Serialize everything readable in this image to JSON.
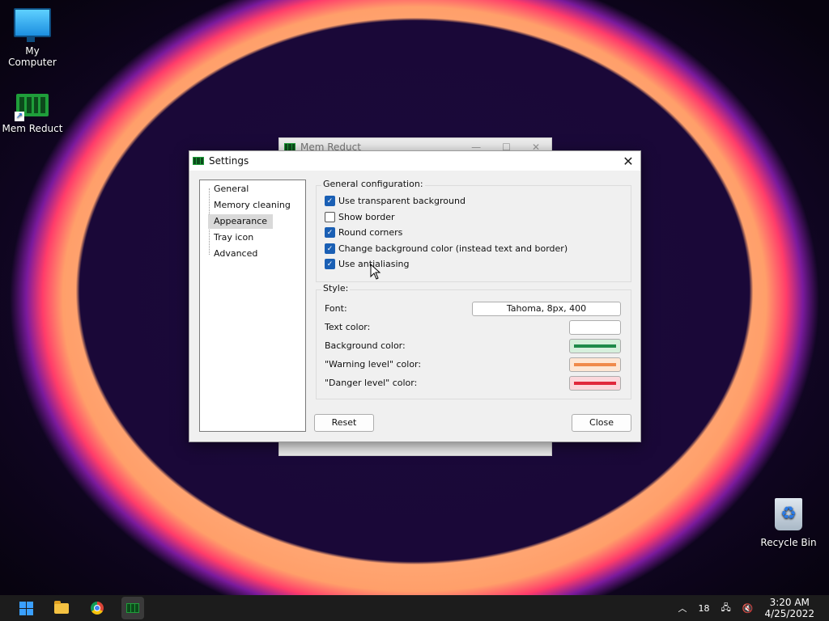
{
  "desktop": {
    "icons": [
      {
        "label": "My Computer"
      },
      {
        "label": "Mem Reduct"
      },
      {
        "label": "Recycle Bin"
      }
    ]
  },
  "background_window": {
    "title": "Mem Reduct"
  },
  "settings": {
    "title": "Settings",
    "close_glyph": "✕",
    "nav": [
      {
        "label": "General"
      },
      {
        "label": "Memory cleaning"
      },
      {
        "label": "Appearance",
        "selected": true
      },
      {
        "label": "Tray icon"
      },
      {
        "label": "Advanced"
      }
    ],
    "general_group": {
      "label": "General configuration:",
      "options": [
        {
          "label": "Use transparent background",
          "checked": true
        },
        {
          "label": "Show border",
          "checked": false
        },
        {
          "label": "Round corners",
          "checked": true
        },
        {
          "label": "Change background color (instead text and border)",
          "checked": true
        },
        {
          "label": "Use antialiasing",
          "checked": true
        }
      ]
    },
    "style_group": {
      "label": "Style:",
      "font_label": "Font:",
      "font_value": "Tahoma, 8px, 400",
      "text_color_label": "Text color:",
      "text_color": "#ffffff",
      "background_color_label": "Background color:",
      "background_color": "#1e8a4a",
      "warning_color_label": "\"Warning level\" color:",
      "warning_color": "#f08a4a",
      "danger_color_label": "\"Danger level\" color:",
      "danger_color": "#e0283c"
    },
    "reset_label": "Reset",
    "close_label": "Close"
  },
  "taskbar": {
    "tray_count": "18",
    "time": "3:20 AM",
    "date": "4/25/2022"
  }
}
